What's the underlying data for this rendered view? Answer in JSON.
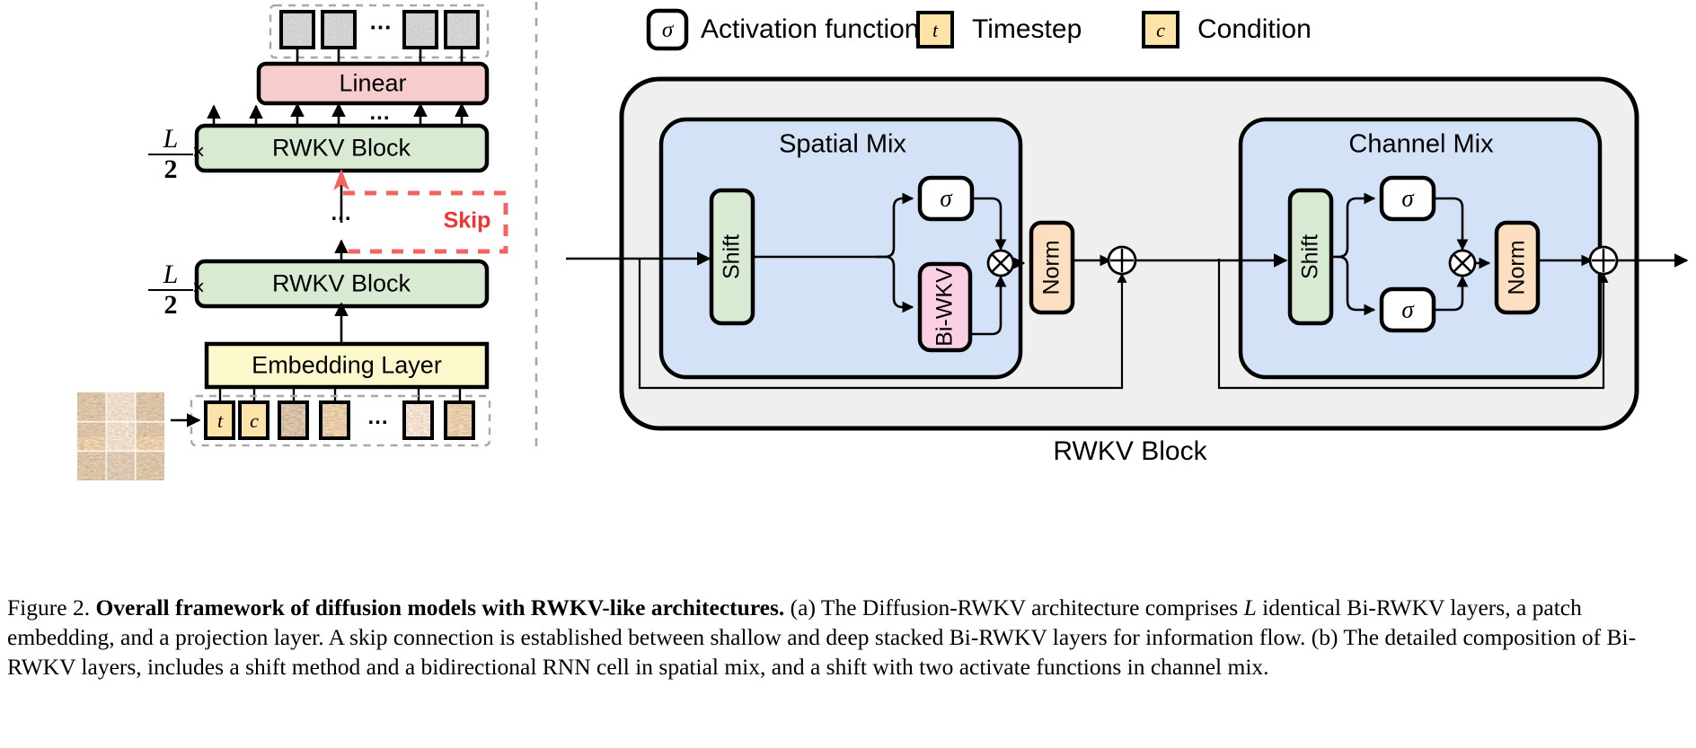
{
  "figure": {
    "panel_a": {
      "repeat_label_numerator": "L",
      "repeat_label_denominator": "2",
      "times_symbol": "×",
      "blocks": {
        "linear": "Linear",
        "rwkv_block_top": "RWKV Block",
        "rwkv_block_bottom": "RWKV Block",
        "embedding": "Embedding Layer"
      },
      "skip_label": "Skip",
      "ellipsis": "...",
      "tokens": {
        "timestep": "t",
        "condition": "c"
      }
    },
    "panel_b": {
      "legend": [
        {
          "symbol": "σ",
          "label": "Activation function",
          "swatch": "#ffffff",
          "shape": "rounded"
        },
        {
          "symbol": "t",
          "label": "Timestep",
          "swatch": "#fde3a7",
          "shape": "square"
        },
        {
          "symbol": "c",
          "label": "Condition",
          "swatch": "#fde3a7",
          "shape": "square"
        }
      ],
      "outer_label": "RWKV Block",
      "groups": [
        {
          "title": "Spatial Mix",
          "nodes": {
            "shift": "Shift",
            "activation": "σ",
            "wkv": "Bi-WKV",
            "norm": "Norm",
            "multiply": "⊗",
            "add": "⊕"
          }
        },
        {
          "title": "Channel Mix",
          "nodes": {
            "shift": "Shift",
            "activation_top": "σ",
            "activation_bottom": "σ",
            "norm": "Norm",
            "multiply": "⊗",
            "add": "⊕"
          }
        }
      ]
    },
    "colors": {
      "green_block": "#d9ead3",
      "pink_block": "#f6cccc",
      "yellow_block": "#fbf8cc",
      "token_yellow": "#fde3a7",
      "blue_group": "#d4e2f7",
      "gray_group": "#eeeeee",
      "orange_norm": "#fbdfc0",
      "magenta_wkv": "#fcd0e4",
      "skip_red": "#f4645f",
      "outline": "#000000",
      "dashed_gray": "#a8a8a8"
    }
  },
  "caption": {
    "prefix": "Figure 2.",
    "bold": "Overall framework of diffusion models with RWKV-like architectures.",
    "body_1": "(a) The Diffusion-RWKV architecture comprises ",
    "italic_1": "L",
    "body_2": " identical Bi-RWKV layers, a patch embedding, and a projection layer. A skip connection is established between shallow and deep stacked Bi-RWKV layers for information flow. (b) The detailed composition of Bi-RWKV layers, includes a shift method and a bidirectional RNN cell in spatial mix, and a shift with two activate functions in channel mix."
  }
}
